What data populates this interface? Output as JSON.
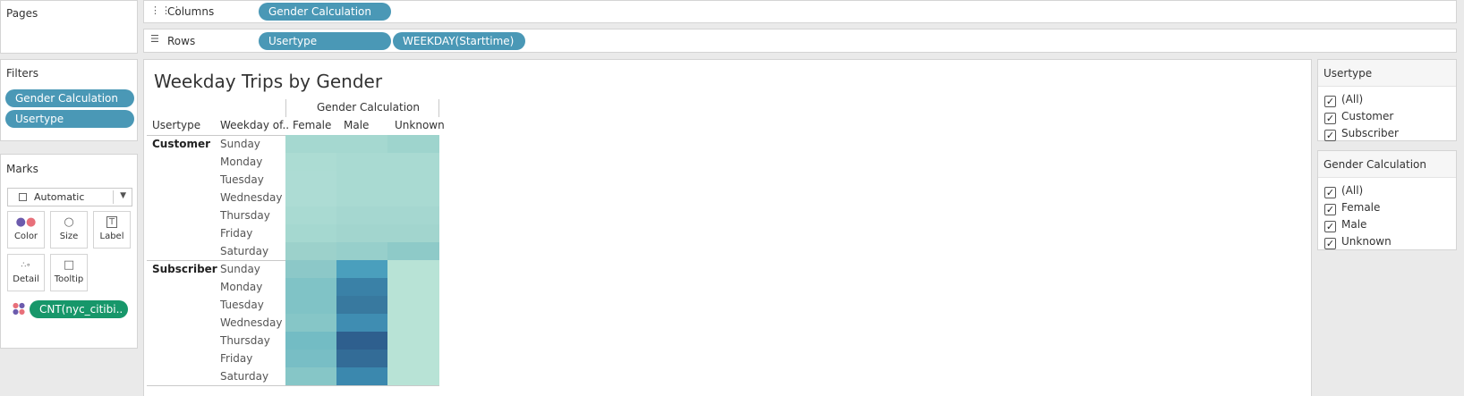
{
  "pages_label": "Pages",
  "columns": {
    "label": "Columns",
    "pills": [
      "Gender Calculation"
    ]
  },
  "rows": {
    "label": "Rows",
    "pills": [
      "Usertype",
      "WEEKDAY(Starttime)"
    ]
  },
  "filters": {
    "title": "Filters",
    "pills": [
      "Gender Calculation",
      "Usertype"
    ]
  },
  "marks": {
    "title": "Marks",
    "type_value": "Automatic",
    "buttons": [
      "Color",
      "Size",
      "Label",
      "Detail",
      "Tooltip"
    ],
    "color_pill": "CNT(nyc_citibi.."
  },
  "view": {
    "title": "Weekday Trips by Gender",
    "col_group_header": "Gender Calculation",
    "row_headers": [
      "Usertype",
      "Weekday of.."
    ],
    "columns": [
      "Female",
      "Male",
      "Unknown"
    ],
    "groups": [
      {
        "name": "Customer",
        "days": [
          "Sunday",
          "Monday",
          "Tuesday",
          "Wednesday",
          "Thursday",
          "Friday",
          "Saturday"
        ]
      },
      {
        "name": "Subscriber",
        "days": [
          "Sunday",
          "Monday",
          "Tuesday",
          "Wednesday",
          "Thursday",
          "Friday",
          "Saturday"
        ]
      }
    ],
    "heat_colors": [
      [
        "#a5d8d0",
        "#a5d8d0",
        "#9ed4cd"
      ],
      [
        "#acdcd3",
        "#a9dad2",
        "#a9dad2"
      ],
      [
        "#addcd4",
        "#a9dad2",
        "#a9dad2"
      ],
      [
        "#addcd4",
        "#a9dad2",
        "#a9dad2"
      ],
      [
        "#a9dad2",
        "#a5d7d0",
        "#a5d7d0"
      ],
      [
        "#a5d8d0",
        "#a2d5ce",
        "#a2d5ce"
      ],
      [
        "#9cd1cb",
        "#97cfcb",
        "#8ecac8"
      ],
      [
        "#8cc8c8",
        "#4a9fbd",
        "#b8e3d6"
      ],
      [
        "#80c3c6",
        "#3a81a7",
        "#b8e3d6"
      ],
      [
        "#80c3c6",
        "#38799f",
        "#b8e3d6"
      ],
      [
        "#86c6c7",
        "#3f8db2",
        "#b8e3d6"
      ],
      [
        "#73bcc4",
        "#2e5f8e",
        "#b8e3d6"
      ],
      [
        "#78bec5",
        "#336c97",
        "#b8e3d6"
      ],
      [
        "#86c6c7",
        "#3b88ae",
        "#b8e3d6"
      ]
    ]
  },
  "usertype_filter": {
    "title": "Usertype",
    "options": [
      "(All)",
      "Customer",
      "Subscriber"
    ]
  },
  "gender_filter": {
    "title": "Gender Calculation",
    "options": [
      "(All)",
      "Female",
      "Male",
      "Unknown"
    ]
  }
}
